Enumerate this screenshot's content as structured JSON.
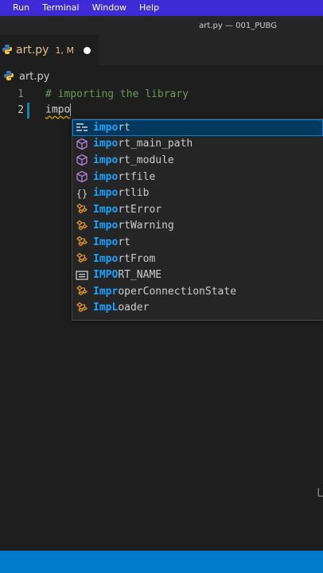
{
  "menubar": {
    "items": [
      "Run",
      "Terminal",
      "Window",
      "Help"
    ]
  },
  "window": {
    "title": "art.py — 001_PUBG"
  },
  "tab": {
    "filename": "art.py",
    "status": "1, M"
  },
  "breadcrumb": {
    "file": "art.py"
  },
  "editor": {
    "lines": [
      {
        "number": "1",
        "text": "# importing the library"
      },
      {
        "number": "2",
        "text": "impo"
      }
    ]
  },
  "suggestions": [
    {
      "kind": "keyword-icon",
      "match": "impo",
      "rest": "rt"
    },
    {
      "kind": "module-icon",
      "match": "impo",
      "rest": "rt_main_path"
    },
    {
      "kind": "module-icon",
      "match": "impo",
      "rest": "rt_module"
    },
    {
      "kind": "module-icon",
      "match": "impo",
      "rest": "rtfile"
    },
    {
      "kind": "namespace-icon",
      "match": "impo",
      "rest": "rtlib"
    },
    {
      "kind": "class-icon",
      "match": "Impo",
      "rest": "rtError"
    },
    {
      "kind": "class-icon",
      "match": "Impo",
      "rest": "rtWarning"
    },
    {
      "kind": "class-icon",
      "match": "Impo",
      "rest": "rt"
    },
    {
      "kind": "class-icon",
      "match": "Impo",
      "rest": "rtFrom"
    },
    {
      "kind": "constant-icon",
      "match": "IMPO",
      "rest": "RT_NAME"
    },
    {
      "kind": "class-icon",
      "match": "Impr",
      "rest": "operConnectionState"
    },
    {
      "kind": "class-icon",
      "match": "ImpL",
      "rest": "oader"
    }
  ],
  "corner_text": "L",
  "colors": {
    "menubar": "#3c2bd6",
    "statusbar": "#007acc",
    "match": "#18a3ff",
    "selection": "#04395e"
  }
}
